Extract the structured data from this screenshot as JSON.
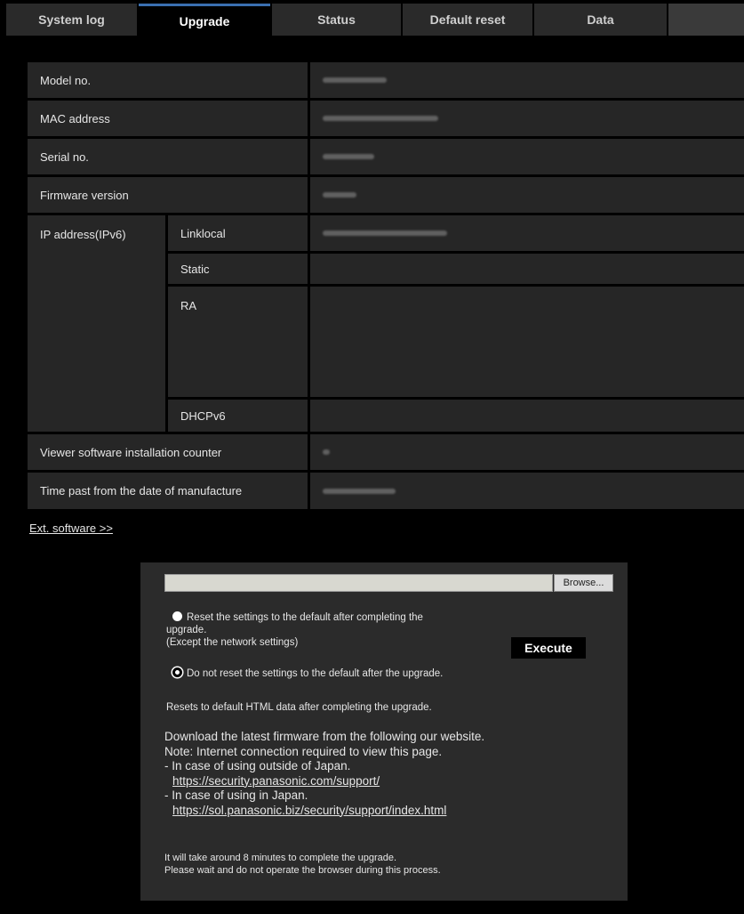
{
  "tabs": [
    {
      "label": "System log",
      "active": false
    },
    {
      "label": "Upgrade",
      "active": true
    },
    {
      "label": "Status",
      "active": false
    },
    {
      "label": "Default reset",
      "active": false
    },
    {
      "label": "Data",
      "active": false
    }
  ],
  "info": {
    "model_label": "Model no.",
    "mac_label": "MAC address",
    "serial_label": "Serial no.",
    "firmware_label": "Firmware version",
    "ipv6_label": "IP address(IPv6)",
    "linklocal_label": "Linklocal",
    "static_label": "Static",
    "ra_label": "RA",
    "dhcpv6_label": "DHCPv6",
    "viewer_label": "Viewer software installation counter",
    "time_label": "Time past from the date of manufacture"
  },
  "ext_software_link": "Ext. software >>",
  "upgrade": {
    "file_value": "",
    "browse_label": "Browse...",
    "option_reset_line1": "Reset the settings to the default after completing the",
    "option_reset_line2": "upgrade.",
    "option_reset_line3": "(Except the network settings)",
    "option_noreset": "Do not reset the settings to the default after the upgrade.",
    "execute_label": "Execute",
    "html_reset_note": "Resets to default HTML data after completing the upgrade.",
    "download_line1": "Download the latest firmware from the following our website.",
    "download_line2": "Note: Internet connection required to view this page.",
    "download_line3": "- In case of using outside of Japan.",
    "url_outside": "https://security.panasonic.com/support/",
    "download_line4": "- In case of using in Japan.",
    "url_japan": "https://sol.panasonic.biz/security/support/index.html",
    "time_note1": "It will take around 8 minutes to complete the upgrade.",
    "time_note2": "Please wait and do not operate the browser during this process."
  }
}
